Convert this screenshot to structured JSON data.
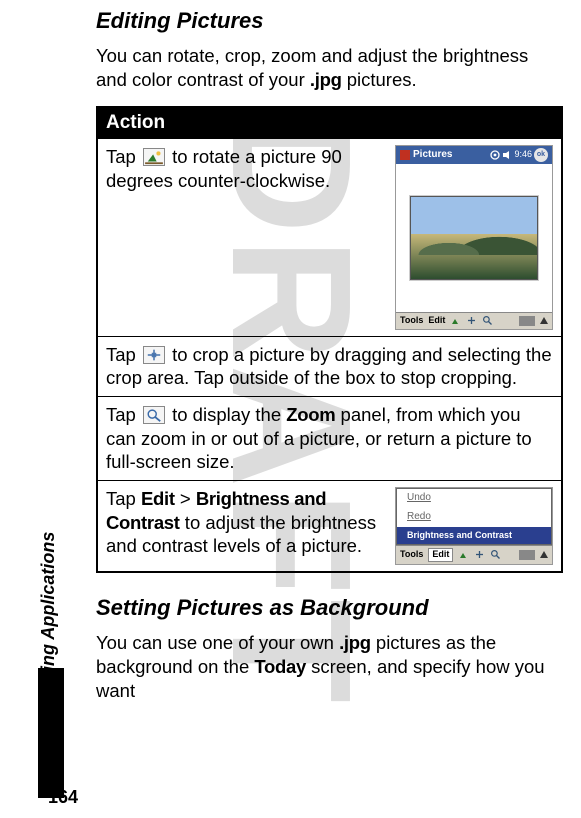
{
  "watermark": "DRAFT",
  "sideLabel": "Using Applications",
  "pageNumber": "164",
  "section1": {
    "heading": "Editing Pictures",
    "intro_a": "You can rotate, crop, zoom and adjust the brightness and color contrast of your ",
    "intro_ext": ".jpg",
    "intro_b": " pictures."
  },
  "tableHeader": "Action",
  "row1": {
    "pre": "Tap ",
    "post": " to rotate a picture 90 degrees counter-clockwise."
  },
  "row2": {
    "pre": "Tap ",
    "post": " to crop a picture by dragging and selecting the crop area. Tap outside of the box to stop cropping."
  },
  "row3": {
    "pre": "Tap ",
    "post_a": " to display the ",
    "zoom": "Zoom",
    "post_b": " panel, from which you can zoom in or out of a picture, or return a picture to full-screen size."
  },
  "row4": {
    "pre": "Tap ",
    "edit": "Edit",
    "gt": " > ",
    "bc": "Brightness and Contrast",
    "post": " to adjust the brightness and contrast levels of a picture."
  },
  "picturesApp": {
    "title": "Pictures",
    "time": "9:46",
    "ok": "ok",
    "tools": "Tools",
    "edit": "Edit"
  },
  "editMenu": {
    "undo": "Undo",
    "redo": "Redo",
    "bc": "Brightness and Contrast",
    "tools": "Tools",
    "edit": "Edit"
  },
  "section2": {
    "heading": "Setting Pictures as Background",
    "body_a": "You can use one of your own ",
    "ext": ".jpg",
    "body_b": " pictures as the background on the ",
    "today": "Today",
    "body_c": " screen, and specify how you want"
  }
}
